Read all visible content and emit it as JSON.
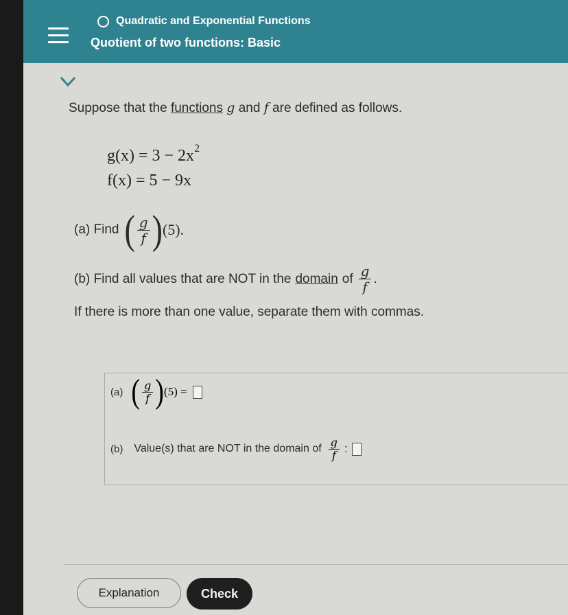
{
  "header": {
    "topic": "Quadratic and Exponential Functions",
    "lesson": "Quotient of two functions: Basic"
  },
  "problem": {
    "intro_prefix": "Suppose that the",
    "intro_link": "functions",
    "intro_g": "g",
    "intro_and": "and",
    "intro_f": "f",
    "intro_suffix": "are defined as follows.",
    "eq_g": "g(x) = 3 − 2x",
    "eq_g_exp": "2",
    "eq_f": "f(x) = 5 − 9x",
    "part_a_label": "(a) Find",
    "part_a_arg": "(5).",
    "frac_num": "g",
    "frac_den": "f",
    "part_b_prefix": "(b) Find all values that are NOT in the",
    "part_b_link": "domain",
    "part_b_of": "of",
    "part_b_period": ".",
    "note": "If there is more than one value, separate them with commas."
  },
  "answers": {
    "a_label": "(a)",
    "a_arg": "(5) =",
    "b_label": "(b)",
    "b_text": "Value(s) that are NOT in the domain of",
    "b_colon": ":"
  },
  "buttons": {
    "explanation": "Explanation",
    "check": "Check"
  },
  "colors": {
    "header_bg": "#2f8390",
    "check_bg": "#1f1f1f"
  }
}
